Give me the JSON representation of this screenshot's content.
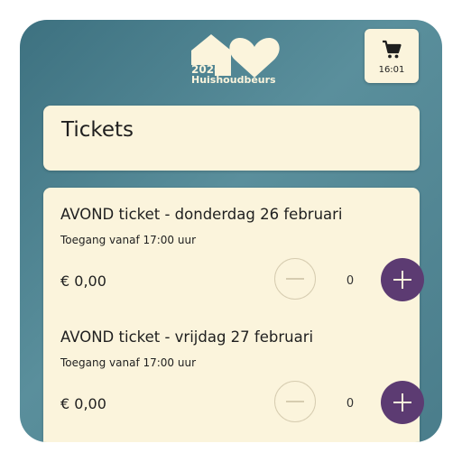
{
  "brand": {
    "year": "2026",
    "name": "Huishoudbeurs",
    "color": "#fbf4dc"
  },
  "cart": {
    "icon": "cart-icon",
    "time": "16:01"
  },
  "page": {
    "title": "Tickets"
  },
  "tickets": [
    {
      "name": "AVOND ticket - donderdag 26 februari",
      "subtitle": "Toegang vanaf 17:00 uur",
      "price": "€ 0,00",
      "quantity": "0"
    },
    {
      "name": "AVOND ticket - vrijdag 27 februari",
      "subtitle": "Toegang vanaf 17:00 uur",
      "price": "€ 0,00",
      "quantity": "0"
    }
  ],
  "colors": {
    "background": "#4a7d8b",
    "card": "#fbf4dc",
    "accent": "#5c3b72"
  }
}
